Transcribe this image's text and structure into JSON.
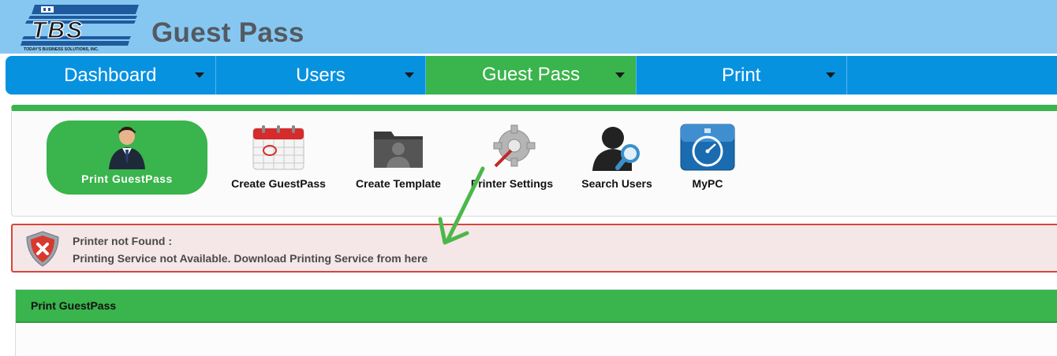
{
  "header": {
    "logo_text": "TBS",
    "logo_tagline": "TODAY'S BUSINESS SOLUTIONS, INC.",
    "title": "Guest Pass"
  },
  "nav": {
    "items": [
      {
        "label": "Dashboard",
        "active": false
      },
      {
        "label": "Users",
        "active": false
      },
      {
        "label": "Guest Pass",
        "active": true
      },
      {
        "label": "Print",
        "active": false
      }
    ]
  },
  "toolbar": {
    "items": [
      {
        "label": "Print GuestPass",
        "icon": "user-icon",
        "active": true
      },
      {
        "label": "Create GuestPass",
        "icon": "calendar-icon",
        "active": false
      },
      {
        "label": "Create Template",
        "icon": "folder-user-icon",
        "active": false
      },
      {
        "label": "Printer Settings",
        "icon": "gear-icon",
        "active": false
      },
      {
        "label": "Search Users",
        "icon": "user-search-icon",
        "active": false
      },
      {
        "label": "MyPC",
        "icon": "stopwatch-icon",
        "active": false
      }
    ]
  },
  "alert": {
    "icon": "shield-error-icon",
    "title": "Printer not Found :",
    "message_prefix": "Printing Service not Available. Download Printing Service from ",
    "link_text": "here"
  },
  "panel": {
    "title": "Print GuestPass"
  },
  "colors": {
    "header_bg": "#86c7f2",
    "nav_blue": "#0792e0",
    "accent_green": "#3ab44c",
    "alert_bg": "#f5e7e7",
    "alert_border": "#d9443b"
  }
}
